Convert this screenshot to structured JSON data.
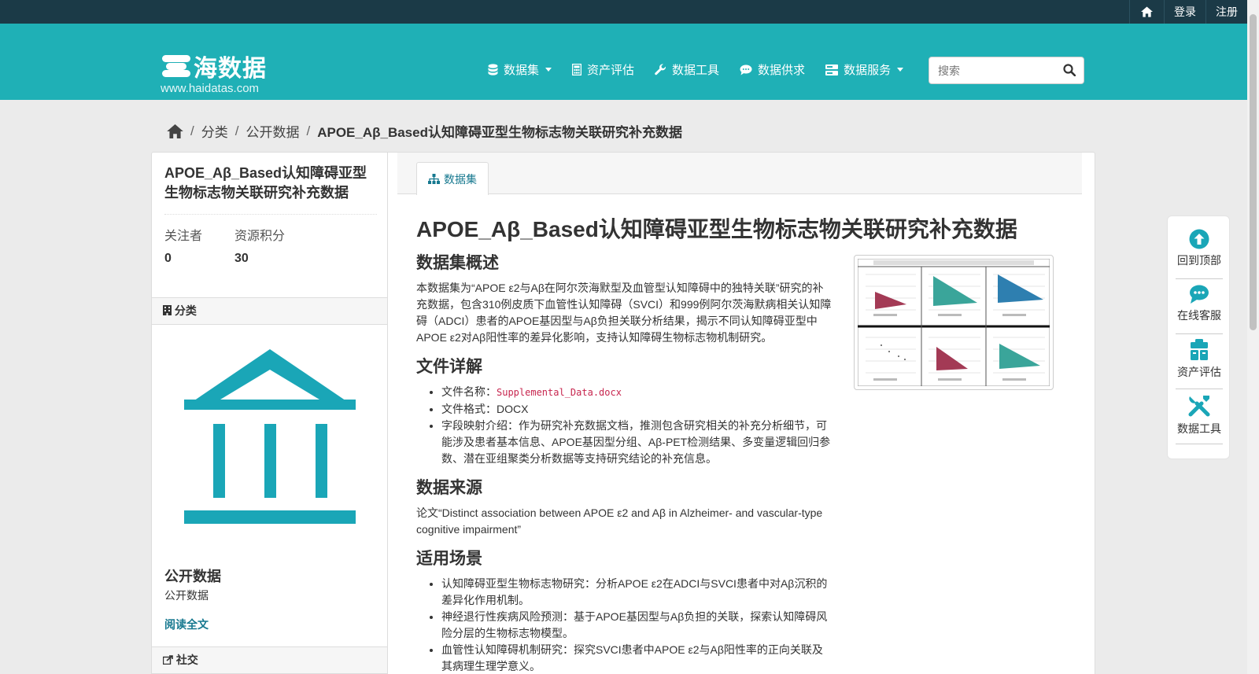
{
  "topbar": {
    "login": "登录",
    "register": "注册"
  },
  "brand": {
    "name": "海数据",
    "url": "www.haidatas.com"
  },
  "nav": [
    {
      "label": "数据集",
      "icon": "database-icon",
      "dropdown": true
    },
    {
      "label": "资产评估",
      "icon": "calculator-icon",
      "dropdown": false
    },
    {
      "label": "数据工具",
      "icon": "wrench-icon",
      "dropdown": false
    },
    {
      "label": "数据供求",
      "icon": "chat-icon",
      "dropdown": false
    },
    {
      "label": "数据服务",
      "icon": "server-icon",
      "dropdown": true
    }
  ],
  "search": {
    "placeholder": "搜索"
  },
  "breadcrumb": {
    "c1": "分类",
    "c2": "公开数据",
    "current": "APOE_Aβ_Based认知障碍亚型生物标志物关联研究补充数据"
  },
  "sidebar": {
    "title": "APOE_Aβ_Based认知障碍亚型生物标志物关联研究补充数据",
    "followers_label": "关注者",
    "followers": "0",
    "points_label": "资源积分",
    "points": "30",
    "category_header": "分类",
    "category_title": "公开数据",
    "category_desc": "公开数据",
    "read_more": "阅读全文",
    "social_header": "社交"
  },
  "tab": {
    "label": "数据集"
  },
  "content": {
    "title": "APOE_Aβ_Based认知障碍亚型生物标志物关联研究补充数据",
    "h_overview": "数据集概述",
    "overview": "本数据集为“APOE ε2与Aβ在阿尔茨海默型及血管型认知障碍中的独特关联”研究的补充数据，包含310例皮质下血管性认知障碍（SVCI）和999例阿尔茨海默病相关认知障碍（ADCI）患者的APOE基因型与Aβ负担关联分析结果，揭示不同认知障碍亚型中APOE ε2对Aβ阳性率的差异化影响，支持认知障碍生物标志物机制研究。",
    "h_files": "文件详解",
    "file_name_label": "文件名称：",
    "file_name": "Supplemental_Data.docx",
    "file_format": "文件格式：DOCX",
    "field_map": "字段映射介绍：作为研究补充数据文档，推测包含研究相关的补充分析细节，可能涉及患者基本信息、APOE基因型分组、Aβ-PET检测结果、多变量逻辑回归参数、潜在亚组聚类分析数据等支持研究结论的补充信息。",
    "h_source": "数据来源",
    "source": "论文“Distinct association between APOE ε2 and Aβ in Alzheimer- and vascular-type cognitive impairment”",
    "h_scenes": "适用场景",
    "scenes": [
      "认知障碍亚型生物标志物研究：分析APOE ε2在ADCI与SVCI患者中对Aβ沉积的差异化作用机制。",
      "神经退行性疾病风险预测：基于APOE基因型与Aβ负担的关联，探索认知障碍风险分层的生物标志物模型。",
      "血管性认知障碍机制研究：探究SVCI患者中APOE ε2与Aβ阳性率的正向关联及其病理生理学意义。"
    ]
  },
  "floatbar": [
    {
      "label": "回到顶部",
      "icon": "arrow-up-circle-icon"
    },
    {
      "label": "在线客服",
      "icon": "chat-bubble-icon"
    },
    {
      "label": "资产评估",
      "icon": "clipboard-icon"
    },
    {
      "label": "数据工具",
      "icon": "tools-icon"
    }
  ],
  "colors": {
    "topbar": "#1b3a47",
    "brand": "#1fb0b6",
    "link": "#16788f",
    "accent": "#1aa6b7"
  }
}
